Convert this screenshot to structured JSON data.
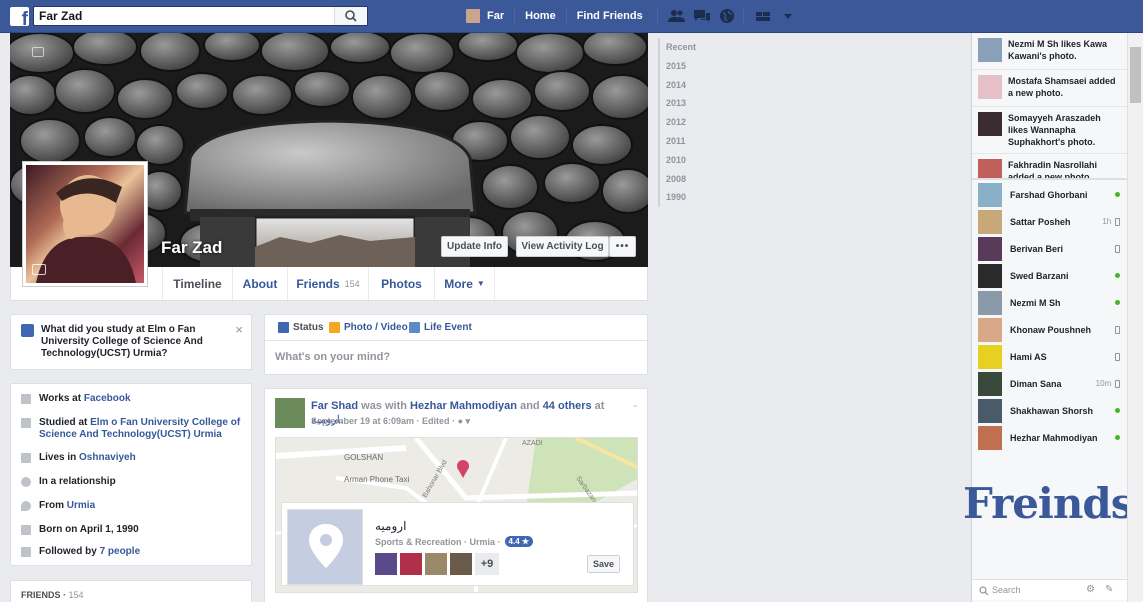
{
  "topbar": {
    "search_value": "Far Zad",
    "nav": [
      "Far",
      "Home",
      "Find Friends"
    ],
    "brand_color": "#3b5998"
  },
  "profile": {
    "name": "Far Zad",
    "buttons": {
      "update_info": "Update Info",
      "activity_log": "View Activity Log",
      "more": "•••"
    },
    "tabs": [
      {
        "label": "Timeline"
      },
      {
        "label": "About"
      },
      {
        "label": "Friends",
        "count": "154"
      },
      {
        "label": "Photos"
      },
      {
        "label": "More"
      }
    ]
  },
  "question": {
    "text": "What did you study at Elm o Fan University College of Science And Technology(UCST) Urmia?",
    "close": "×"
  },
  "intro": [
    {
      "icon": "briefcase-icon",
      "prefix": "Works at ",
      "link": "Facebook"
    },
    {
      "icon": "school-icon",
      "prefix": "Studied at ",
      "link": "Elm o Fan University College of Science And Technology(UCST) Urmia"
    },
    {
      "icon": "home-icon",
      "prefix": "Lives in ",
      "link": "Oshnaviyeh"
    },
    {
      "icon": "heart-icon",
      "prefix": "In a relationship",
      "link": ""
    },
    {
      "icon": "location-icon",
      "prefix": "From ",
      "link": "Urmia"
    },
    {
      "icon": "calendar-icon",
      "prefix": "Born on April 1, 1990",
      "link": ""
    },
    {
      "icon": "rss-icon",
      "prefix": "Followed by ",
      "link": "7 people"
    }
  ],
  "friends_box": {
    "label": "FRIENDS",
    "count": "154"
  },
  "composer": {
    "tabs": [
      "Status",
      "Photo / Video",
      "Life Event"
    ],
    "placeholder": "What's on your mind?"
  },
  "post": {
    "author": "Far Shad",
    "with_text": " was with ",
    "with_name": "Hezhar Mahmodiyan",
    "and_text": " and ",
    "others": "44 others",
    "at_text": " at ",
    "place_rtl": "ارومیه.",
    "meta": "September 19 at 6:09am · Edited ·",
    "map_labels": [
      "AZADI",
      "Sarbazan-e-Gomna",
      "GOLSHAN",
      "Arman Phone Taxi",
      "Bahonar Blvd"
    ],
    "place": {
      "name": "ارومیه",
      "category": "Sports & Recreation · Urmia ·",
      "rating": "4.4 ★",
      "more_count": "+9",
      "save": "Save"
    }
  },
  "years": [
    "Recent",
    "2015",
    "2014",
    "2013",
    "2012",
    "2011",
    "2010",
    "2008",
    "1990"
  ],
  "ticker": [
    {
      "text": "Nezmi M Sh likes Kawa Kawani's photo."
    },
    {
      "text": "Mostafa Shamsaei added a new photo."
    },
    {
      "text": "Somayyeh Araszadeh likes Wannapha Suphakhort's photo."
    },
    {
      "text": "Fakhradin Nasrollahi added a new photo."
    }
  ],
  "chat": [
    {
      "name": "Farshad Ghorbani",
      "status": "online"
    },
    {
      "name": "Sattar Posheh",
      "time": "1h",
      "status": "mobile"
    },
    {
      "name": "Berivan Beri",
      "status": "mobile"
    },
    {
      "name": "Swed Barzani",
      "status": "online"
    },
    {
      "name": "Nezmi M Sh",
      "status": "online"
    },
    {
      "name": "Khonaw Poushneh",
      "status": "mobile"
    },
    {
      "name": "Hami AS",
      "status": "mobile"
    },
    {
      "name": "Diman Sana",
      "time": "10m",
      "status": "mobile"
    },
    {
      "name": "Shakhawan Shorsh",
      "status": "online"
    },
    {
      "name": "Hezhar Mahmodiyan",
      "status": "online"
    }
  ],
  "overlay_text": "Freinds",
  "chat_search": "Search",
  "colors": {
    "link": "#365899",
    "online": "#42b72a",
    "accent": "#4267b2"
  }
}
